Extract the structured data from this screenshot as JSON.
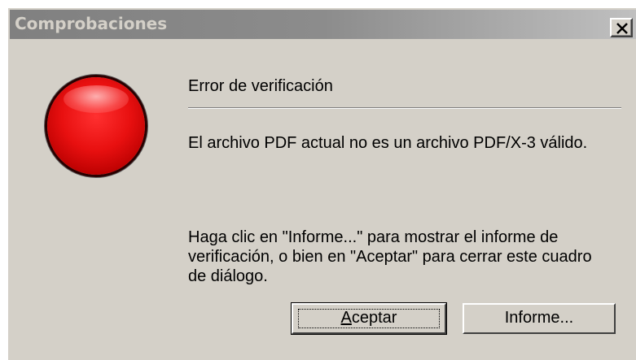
{
  "window": {
    "title": "Comprobaciones",
    "close_glyph": "close-icon"
  },
  "icon": "error-orb-icon",
  "content": {
    "heading": "Error de verificación",
    "message": "El archivo PDF actual no es un archivo PDF/X-3 válido.",
    "instructions": "Haga clic en \"Informe...\" para mostrar el informe de verificación, o bien en \"Aceptar\" para cerrar este cuadro de diálogo."
  },
  "buttons": {
    "ok_accel": "A",
    "ok_rest": "ceptar",
    "report_label": "Informe..."
  },
  "colors": {
    "dialog_bg": "#d4d0c8",
    "titlebar": "#808080",
    "error_red": "#e81010"
  }
}
